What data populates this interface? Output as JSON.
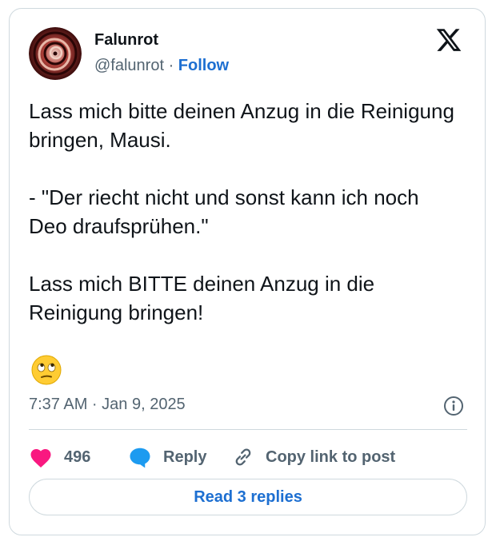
{
  "author": {
    "display_name": "Falunrot",
    "handle": "@falunrot",
    "separator": " · ",
    "follow_label": "Follow"
  },
  "post": {
    "paragraphs": [
      "Lass mich bitte deinen Anzug in die Reinigung bringen, Mausi.",
      "- \"Der riecht nicht und sonst kann ich noch Deo draufsprühen.\"",
      "Lass mich BITTE deinen Anzug in die Reinigung bringen!"
    ],
    "emoji": "face-with-rolling-eyes",
    "timestamp": "7:37 AM · Jan 9, 2025"
  },
  "actions": {
    "like_count": "496",
    "reply_label": "Reply",
    "copy_link_label": "Copy link to post"
  },
  "read_replies_label": "Read 3 replies",
  "colors": {
    "like": "#f91880",
    "reply": "#1d9bf0",
    "link": "#1d6fd1",
    "secondary_text": "#536471",
    "border": "#cfd9de"
  },
  "icons": [
    "x-logo-icon",
    "info-icon",
    "heart-icon",
    "reply-bubble-icon",
    "link-icon"
  ]
}
